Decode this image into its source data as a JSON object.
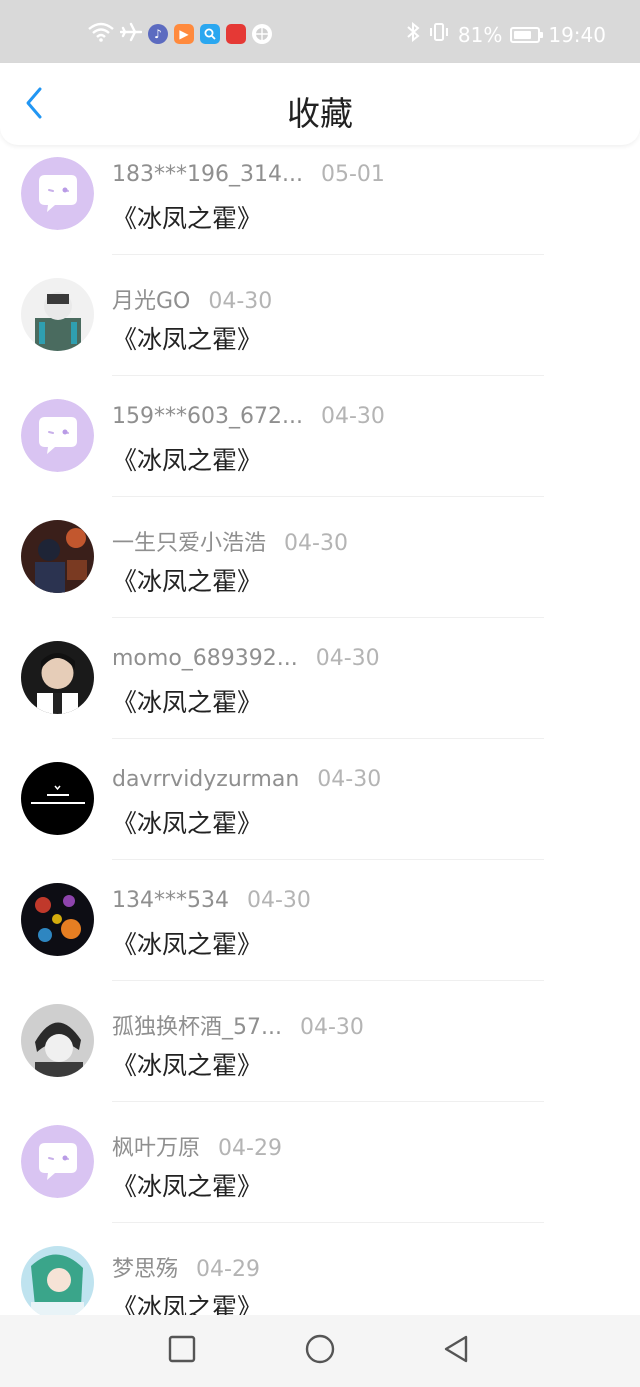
{
  "status_bar": {
    "battery": "81%",
    "time": "19:40",
    "icons": [
      "wifi-icon",
      "airplane-icon",
      "music-app-icon",
      "video-app-icon",
      "search-app-icon",
      "store-app-icon",
      "ball-app-icon",
      "bluetooth-icon",
      "vibrate-icon",
      "battery-icon"
    ]
  },
  "header": {
    "title": "收藏",
    "back_icon": "chevron-left-icon"
  },
  "items": [
    {
      "username": "183***196_314...",
      "date": "05-01",
      "book": "《冰凤之霍》",
      "avatar": "default"
    },
    {
      "username": "月光GO",
      "date": "04-30",
      "book": "《冰凤之霍》",
      "avatar": "photo-1"
    },
    {
      "username": "159***603_672...",
      "date": "04-30",
      "book": "《冰凤之霍》",
      "avatar": "default"
    },
    {
      "username": "一生只爱小浩浩",
      "date": "04-30",
      "book": "《冰凤之霍》",
      "avatar": "photo-2"
    },
    {
      "username": "momo_689392...",
      "date": "04-30",
      "book": "《冰凤之霍》",
      "avatar": "photo-3"
    },
    {
      "username": "davrrvidyzurman",
      "date": "04-30",
      "book": "《冰凤之霍》",
      "avatar": "photo-4"
    },
    {
      "username": "134***534",
      "date": "04-30",
      "book": "《冰凤之霍》",
      "avatar": "photo-5"
    },
    {
      "username": "孤独换杯酒_57...",
      "date": "04-30",
      "book": "《冰凤之霍》",
      "avatar": "photo-6"
    },
    {
      "username": "枫叶万原",
      "date": "04-29",
      "book": "《冰凤之霍》",
      "avatar": "default"
    },
    {
      "username": "梦思殇",
      "date": "04-29",
      "book": "《冰凤之霍》",
      "avatar": "photo-7"
    }
  ],
  "nav_bar": {
    "icons": [
      "recents-square-icon",
      "home-circle-icon",
      "back-triangle-icon"
    ]
  },
  "colors": {
    "status_bar_bg": "#d9d9d9",
    "accent": "#2196f3",
    "default_avatar": "#d9c4f2"
  }
}
